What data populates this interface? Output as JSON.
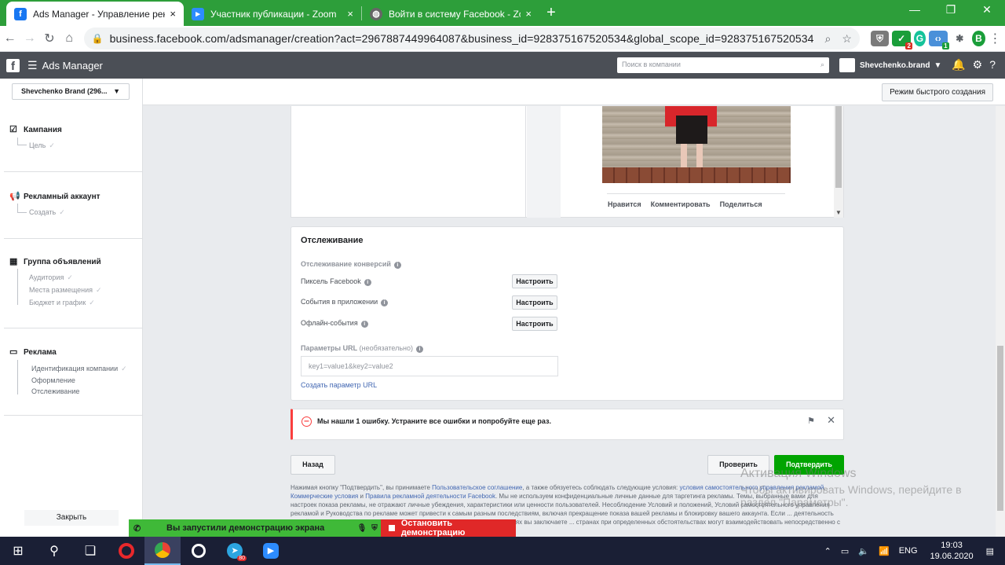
{
  "browser": {
    "tabs": [
      {
        "title": "Ads Manager - Управление рекл",
        "active": true,
        "icon": "facebook-icon"
      },
      {
        "title": "Участник публикации - Zoom",
        "active": false,
        "icon": "zoom-icon"
      },
      {
        "title": "Войти в систему Facebook - Zoo",
        "active": false,
        "icon": "globe-icon"
      }
    ],
    "new_tab": "+",
    "url": "business.facebook.com/adsmanager/creation?act=2967887449964087&business_id=928375167520534&global_scope_id=928375167520534",
    "ext_badge_1": "2",
    "ext_badge_2": "1",
    "profile_letter": "B"
  },
  "header": {
    "app_title": "Ads Manager",
    "search_placeholder": "Поиск в компании",
    "account_name": "Shevchenko.brand"
  },
  "sidebar": {
    "account_selector": "Shevchenko Brand (296...",
    "sections": [
      {
        "title": "Кампания",
        "items": [
          "Цель"
        ]
      },
      {
        "title": "Рекламный аккаунт",
        "items": [
          "Создать"
        ]
      },
      {
        "title": "Группа объявлений",
        "items": [
          "Аудитория",
          "Места размещения",
          "Бюджет и график"
        ]
      },
      {
        "title": "Реклама",
        "items": [
          "Идентификация компании",
          "Оформление",
          "Отслеживание"
        ]
      }
    ],
    "close_label": "Закрыть"
  },
  "topbar": {
    "quick_create": "Режим быстрого создания"
  },
  "preview": {
    "actions": [
      "Нравится",
      "Комментировать",
      "Поделиться"
    ]
  },
  "tracking": {
    "title": "Отслеживание",
    "conversion_label": "Отслеживание конверсий",
    "rows": [
      {
        "label": "Пиксель Facebook",
        "button": "Настроить"
      },
      {
        "label": "События в приложении",
        "button": "Настроить"
      },
      {
        "label": "Офлайн-события",
        "button": "Настроить"
      }
    ],
    "url_params_label": "Параметры URL",
    "url_params_optional": "(необязательно)",
    "url_params_placeholder": "key1=value1&key2=value2",
    "create_param_link": "Создать параметр URL"
  },
  "error": {
    "message": "Мы нашли 1 ошибку. Устраните все ошибки и попробуйте еще раз."
  },
  "footer_buttons": {
    "back": "Назад",
    "review": "Проверить",
    "confirm": "Подтвердить"
  },
  "legal": {
    "p1": "Нажимая кнопку \"Подтвердить\", вы принимаете ",
    "link1": "Пользовательское соглашение",
    "p2": ", а также обязуетесь соблюдать следующие условия: ",
    "link2": "условия самостоятельного управления рекламой",
    "p3": ", ",
    "link3": "Коммерческие условия",
    "p4": " и ",
    "link4": "Правила рекламной деятельности Facebook",
    "p5": ". Мы не используем конфиденциальные личные данные для таргетинга рекламы. Темы, выбранные вами для настроек показа рекламы, не отражают личные убеждения, характеристики или ценности пользователей. Несоблюдение Условий и положений, Условий самостоятельного управления рекламой и Руководства по рекламе может привести к самым разным последствиям, включая прекращение показа вашей рекламы и блокировку вашего аккаунта. Если ... деятельность вашей компании, вы заключаете договор с Facebook, Inc. В остальных случаях вы заключаете ... странах при определенных обстоятельствах могут взаимодействовать непосредственно с"
  },
  "watermark": {
    "line1": "Активация Windows",
    "line2": "Чтобы активировать Windows, перейдите в",
    "line3": "раздел \"Параметры\"."
  },
  "zoom": {
    "sharing_text": "Вы запустили демонстрацию экрана",
    "stop_text": "Остановить демонстрацию"
  },
  "taskbar": {
    "telegram_badge": "80",
    "lang": "ENG",
    "time": "19:03",
    "date": "19.06.2020"
  },
  "colors": {
    "chrome_green": "#2d9e3a",
    "fb_header": "#4b4f56",
    "confirm_green": "#00a400",
    "error_red": "#fa3e3e",
    "link_blue": "#4267b2"
  }
}
